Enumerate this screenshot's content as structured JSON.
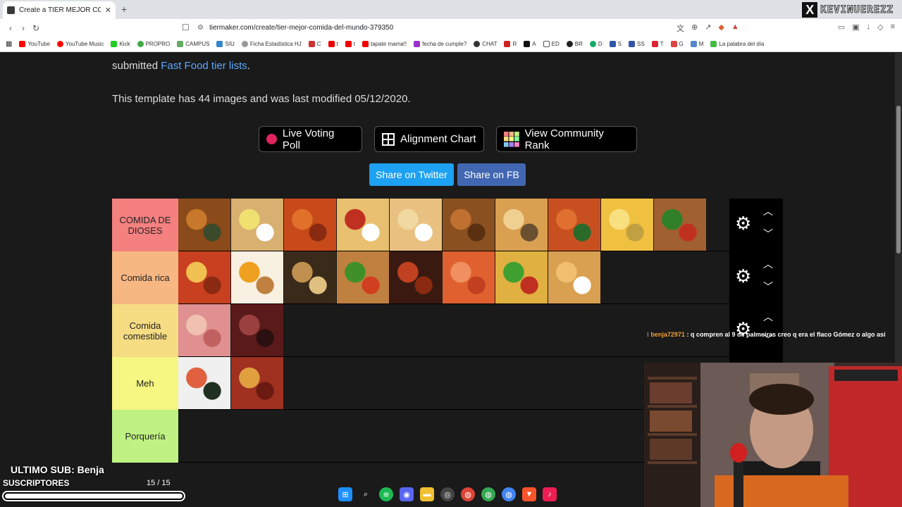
{
  "browser": {
    "tab_title": "Create a TIER MEJOR COMIDA D...",
    "url": "tiermaker.com/create/tier-mejor-comida-del-mundo-379350",
    "overlay_name": "KEVINUEREZZ",
    "bookmarks": [
      "YouTube",
      "YouTube Music",
      "Kick",
      "PROPRO",
      "CAMPUS",
      "SIU",
      "Ficha Estadística HJ",
      "C",
      "t",
      "t",
      "tapate mama!!",
      "fecha de cumple?",
      "CHAT",
      "R",
      "A",
      "ED",
      "BR",
      "D",
      "S",
      "SS",
      "T",
      "G",
      "M",
      "La palabra del día"
    ]
  },
  "page": {
    "intro_text": "submitted",
    "intro_link": "Fast Food tier lists",
    "intro_end": ".",
    "template_info": "This template has 44 images and was last modified 05/12/2020.",
    "buttons": {
      "live_poll": "Live Voting Poll",
      "alignment": "Alignment Chart",
      "community": "View Community Rank",
      "twitter": "Share on Twitter",
      "fb": "Share on FB"
    }
  },
  "tiers": [
    {
      "label": "COMIDA DE DIOSES",
      "color": "#f48080",
      "items": [
        "roast-chicken",
        "milanesa",
        "penne-pasta",
        "spaghetti",
        "onion-rings",
        "croquettes",
        "empanadas",
        "soup",
        "tortilla",
        "burger"
      ]
    },
    {
      "label": "Comida rica",
      "color": "#f6b783",
      "items": [
        "pizza",
        "fried-egg",
        "ramen",
        "hamburger",
        "meatballs",
        "shrimp",
        "tacos",
        "nuggets"
      ]
    },
    {
      "label": "Comida comestible",
      "color": "#f6dc83",
      "items": [
        "prosciutto",
        "salami"
      ]
    },
    {
      "label": "Meh",
      "color": "#f6f683",
      "items": [
        "sushi",
        "sausages"
      ]
    },
    {
      "label": "Porquería",
      "color": "#bff283",
      "items": []
    }
  ],
  "stream": {
    "chat_user": "benja72971",
    "chat_message": ": q compren al 9 de palmeiras creo q era el flaco Gómez o algo así",
    "ultimo_sub": "ULTIMO SUB: Benja",
    "subs_label": "SUSCRIPTORES",
    "subs_count": "15 / 15",
    "subs_progress": 1.0
  }
}
